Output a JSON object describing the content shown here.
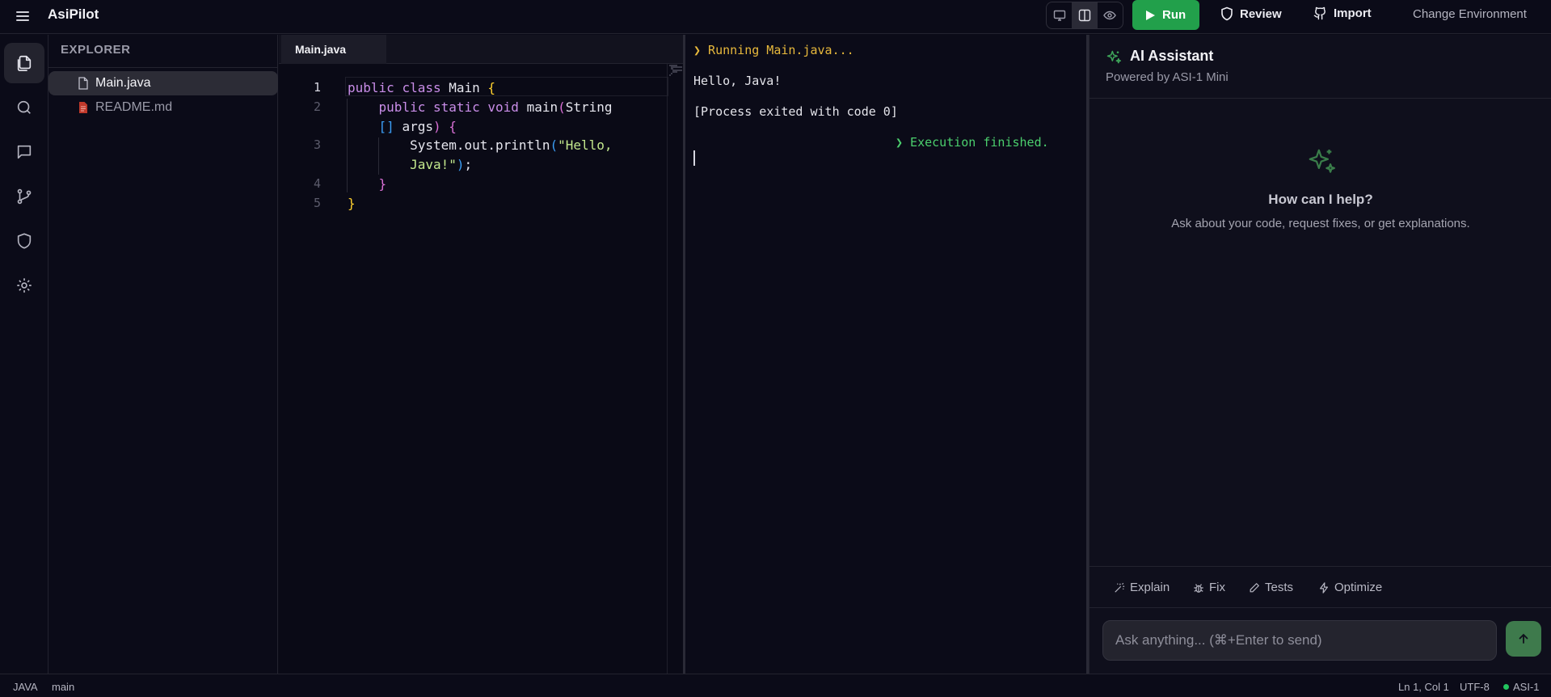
{
  "app": {
    "title": "AsiPilot"
  },
  "header": {
    "run_label": "Run",
    "review_label": "Review",
    "import_label": "Import",
    "change_env_label": "Change Environment",
    "view_modes": [
      "desktop",
      "split",
      "preview"
    ],
    "active_view": "split"
  },
  "activity_bar": {
    "items": [
      "files",
      "search",
      "chat",
      "source-control",
      "security",
      "settings"
    ],
    "active": "files"
  },
  "explorer": {
    "title": "EXPLORER",
    "files": [
      {
        "name": "Main.java",
        "active": true
      },
      {
        "name": "README.md",
        "active": false
      }
    ]
  },
  "editor": {
    "tab": "Main.java",
    "line_numbers": [
      "1",
      "2",
      "3",
      "4",
      "5"
    ],
    "current_line": 1,
    "code": {
      "l1_kw1": "public",
      "l1_kw2": "class",
      "l1_name": "Main",
      "l1_brace": "{",
      "l2_kw1": "public",
      "l2_kw2": "static",
      "l2_kw3": "void",
      "l2_fn": "main",
      "l2_paren": "(",
      "l2_type": "String",
      "l2b_brackets": "[]",
      "l2b_arg": "args",
      "l2b_paren": ")",
      "l2b_brace": "{",
      "l3_call": "System.out.println",
      "l3_paren": "(",
      "l3_str1": "\"Hello,",
      "l3b_str2": "Java!\"",
      "l3b_paren": ")",
      "l3b_semi": ";",
      "l4_brace": "}",
      "l5_brace": "}"
    }
  },
  "terminal": {
    "running": "❯ Running Main.java...",
    "output": "Hello, Java!",
    "exit": "[Process exited with code 0]",
    "finished": "❯ Execution finished."
  },
  "assistant": {
    "title": "AI Assistant",
    "subtitle": "Powered by ASI-1 Mini",
    "empty_title": "How can I help?",
    "empty_sub": "Ask about your code, request fixes, or get explanations.",
    "actions": [
      "Explain",
      "Fix",
      "Tests",
      "Optimize"
    ],
    "input_placeholder": "Ask anything... (⌘+Enter to send)"
  },
  "statusbar": {
    "language": "JAVA",
    "branch": "main",
    "cursor": "Ln 1, Col 1",
    "encoding": "UTF-8",
    "model": "ASI-1",
    "model_status_color": "#22c55e"
  },
  "colors": {
    "background": "#0b0b18",
    "run_button": "#22a04b",
    "assistant_accent": "#3ea55a",
    "keyword": "#c98de8",
    "string": "#c3e88d",
    "bracket_gold": "#ffd02e",
    "bracket_magenta": "#da70d6",
    "bracket_blue": "#3b9ef6",
    "terminal_running": "#e8b93c",
    "terminal_success": "#4bcf6d"
  }
}
